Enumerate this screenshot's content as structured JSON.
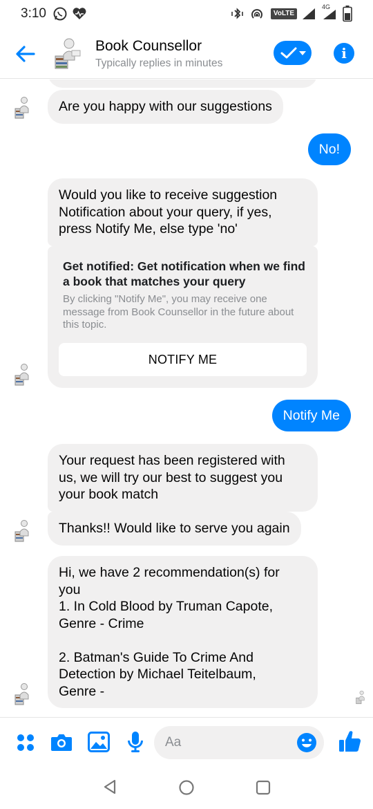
{
  "status_bar": {
    "time": "3:10",
    "volte_label": "VoLTE",
    "network_label": "4G"
  },
  "header": {
    "title": "Book Counsellor",
    "subtitle": "Typically replies in minutes"
  },
  "messages": {
    "m1": "Are you happy with our suggestions",
    "m2": "No!",
    "m3": "Would you like to receive suggestion\nNotification about your query, if yes,\npress Notify Me, else type 'no'",
    "card_title": "Get notified: Get notification when we find a book that matches your query",
    "card_body": "By clicking \"Notify Me\", you may receive one message from Book Counsellor in the future about this topic.",
    "card_button": "NOTIFY ME",
    "m4": "Notify Me",
    "m5": "Your request has been registered with\nus, we will try our best to suggest you\nyour book match",
    "m6": "Thanks!! Would like to serve you again",
    "m7": "Hi, we have 2 recommendation(s) for\nyou\n1. In Cold Blood by Truman Capote,\nGenre - Crime\n\n2. Batman's Guide To Crime And\nDetection by Michael Teitelbaum,\nGenre -"
  },
  "composer": {
    "placeholder": "Aa"
  },
  "colors": {
    "accent": "#0084ff",
    "bubble_in": "#f1f0f0"
  }
}
